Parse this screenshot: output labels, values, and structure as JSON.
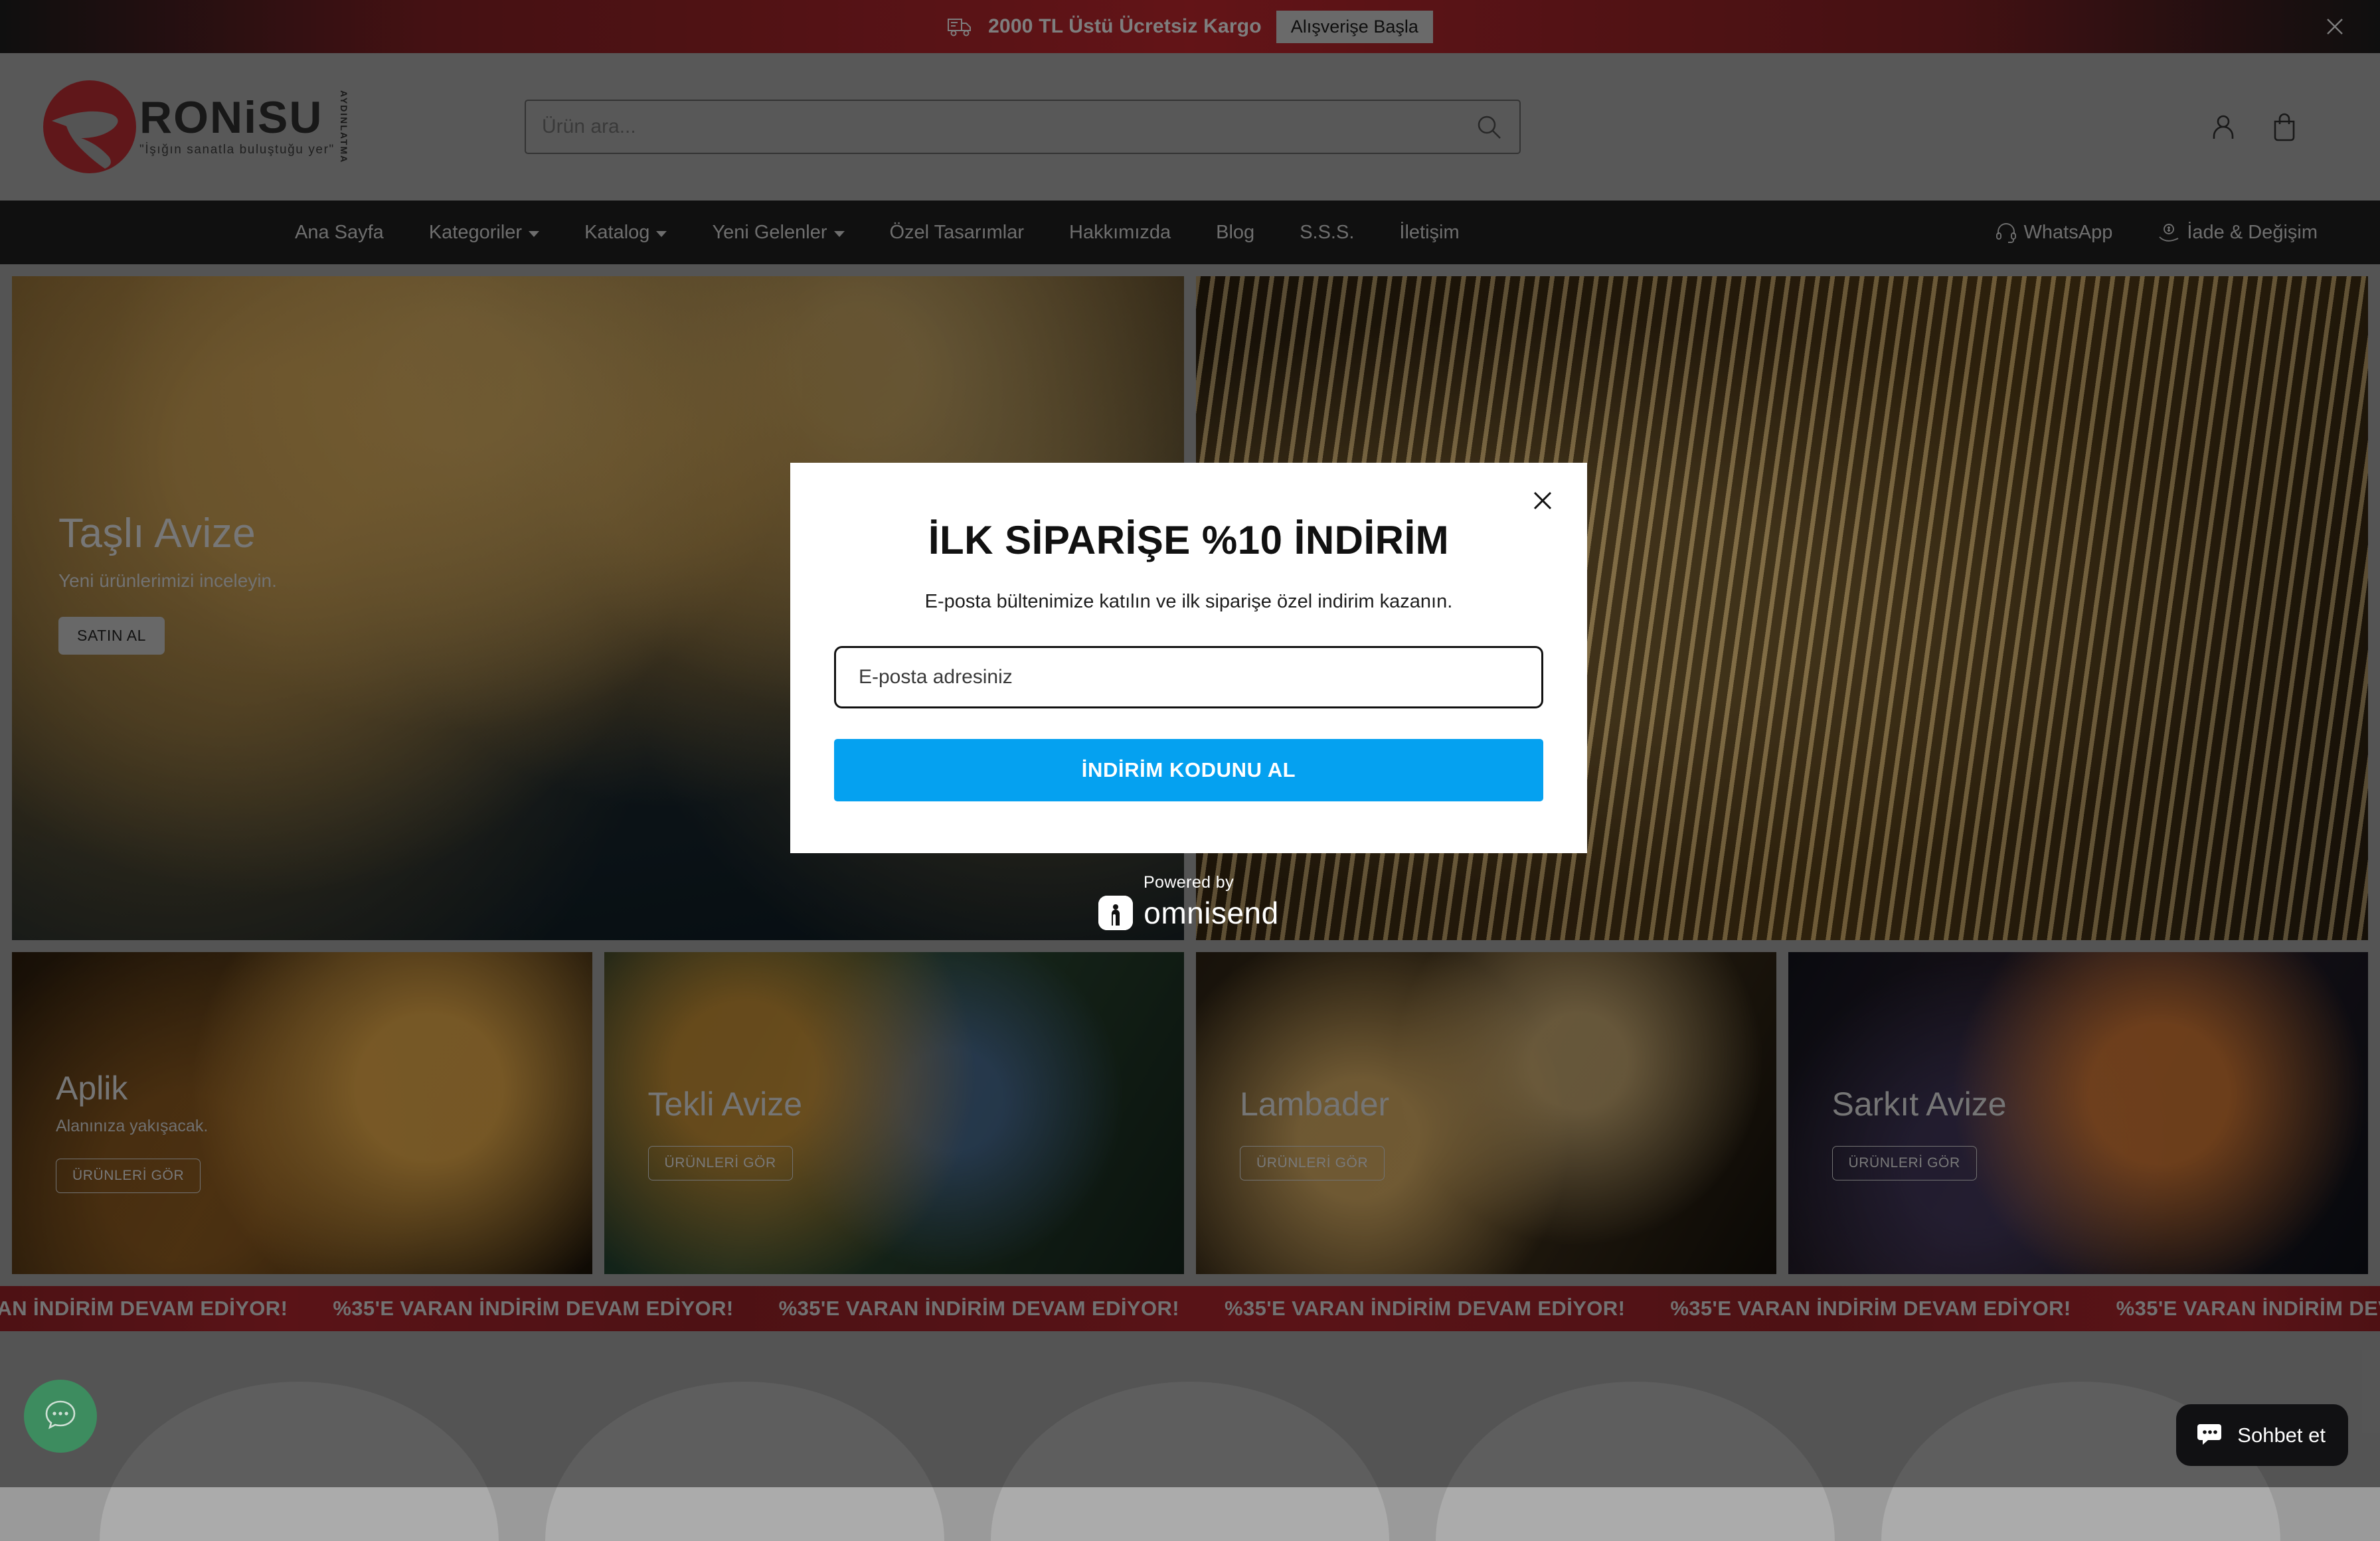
{
  "announcement": {
    "icon": "delivery-truck-icon",
    "text": "2000 TL Üstü Ücretsiz Kargo",
    "cta_label": "Alışverişe Başla",
    "close_icon": "close-icon"
  },
  "header": {
    "logo": {
      "name": "RONiSU",
      "tagline": "\"İşığın sanatla buluştuğu yer\"",
      "vertical": "AYDINLATMA"
    },
    "search": {
      "placeholder": "Ürün ara...",
      "value": "",
      "icon": "search-icon"
    },
    "account_icon": "user-account-icon",
    "cart_icon": "shopping-bag-icon"
  },
  "nav": {
    "items": [
      {
        "label": "Ana Sayfa",
        "has_dropdown": false
      },
      {
        "label": "Kategoriler",
        "has_dropdown": true
      },
      {
        "label": "Katalog",
        "has_dropdown": true
      },
      {
        "label": "Yeni Gelenler",
        "has_dropdown": true
      },
      {
        "label": "Özel Tasarımlar",
        "has_dropdown": false
      },
      {
        "label": "Hakkımızda",
        "has_dropdown": false
      },
      {
        "label": "Blog",
        "has_dropdown": false
      },
      {
        "label": "S.S.S.",
        "has_dropdown": false
      },
      {
        "label": "İletişim",
        "has_dropdown": false
      }
    ],
    "right_items": [
      {
        "label": "WhatsApp",
        "icon": "headset-icon"
      },
      {
        "label": "İade & Değişim",
        "icon": "money-back-hand-icon"
      }
    ]
  },
  "hero": {
    "slides": [
      {
        "title": "Taşlı Avize",
        "subtitle": "Yeni ürünlerimizi inceleyin.",
        "cta_label": "SATIN AL"
      },
      {
        "title": "",
        "subtitle": "",
        "cta_label": ""
      }
    ]
  },
  "categories": [
    {
      "title": "Aplik",
      "subtitle": "Alanınıza yakışacak.",
      "cta_label": "ÜRÜNLERİ GÖR"
    },
    {
      "title": "Tekli Avize",
      "subtitle": "",
      "cta_label": "ÜRÜNLERİ GÖR"
    },
    {
      "title": "Lambader",
      "subtitle": "",
      "cta_label": "ÜRÜNLERİ GÖR"
    },
    {
      "title": "Sarkıt Avize",
      "subtitle": "",
      "cta_label": "ÜRÜNLERİ GÖR"
    }
  ],
  "marquee": {
    "text": "%35'E VARAN İNDİRİM DEVAM EDİYOR!",
    "repeats": 8
  },
  "widgets": {
    "whatsapp_bubble_icon": "chat-bubble-icon",
    "chat": {
      "label": "Sohbet et",
      "icon": "chat-bubble-icon"
    }
  },
  "modal": {
    "title": "İLK SİPARİŞE %10 İNDİRİM",
    "subtitle": "E-posta bültenimize katılın ve ilk siparişe özel indirim kazanın.",
    "email_placeholder": "E-posta adresiniz",
    "email_value": "",
    "submit_label": "İNDİRİM KODUNU AL",
    "close_icon": "close-icon",
    "powered_by_label": "Powered by",
    "powered_by_brand": "omnisend"
  },
  "colors": {
    "accent_blue": "#05a1f0",
    "brand_red": "#a4242b",
    "nav_dark": "#1e1e1e",
    "page_bg": "#9a9a9a",
    "whatsapp_green": "#3d8c5f"
  }
}
